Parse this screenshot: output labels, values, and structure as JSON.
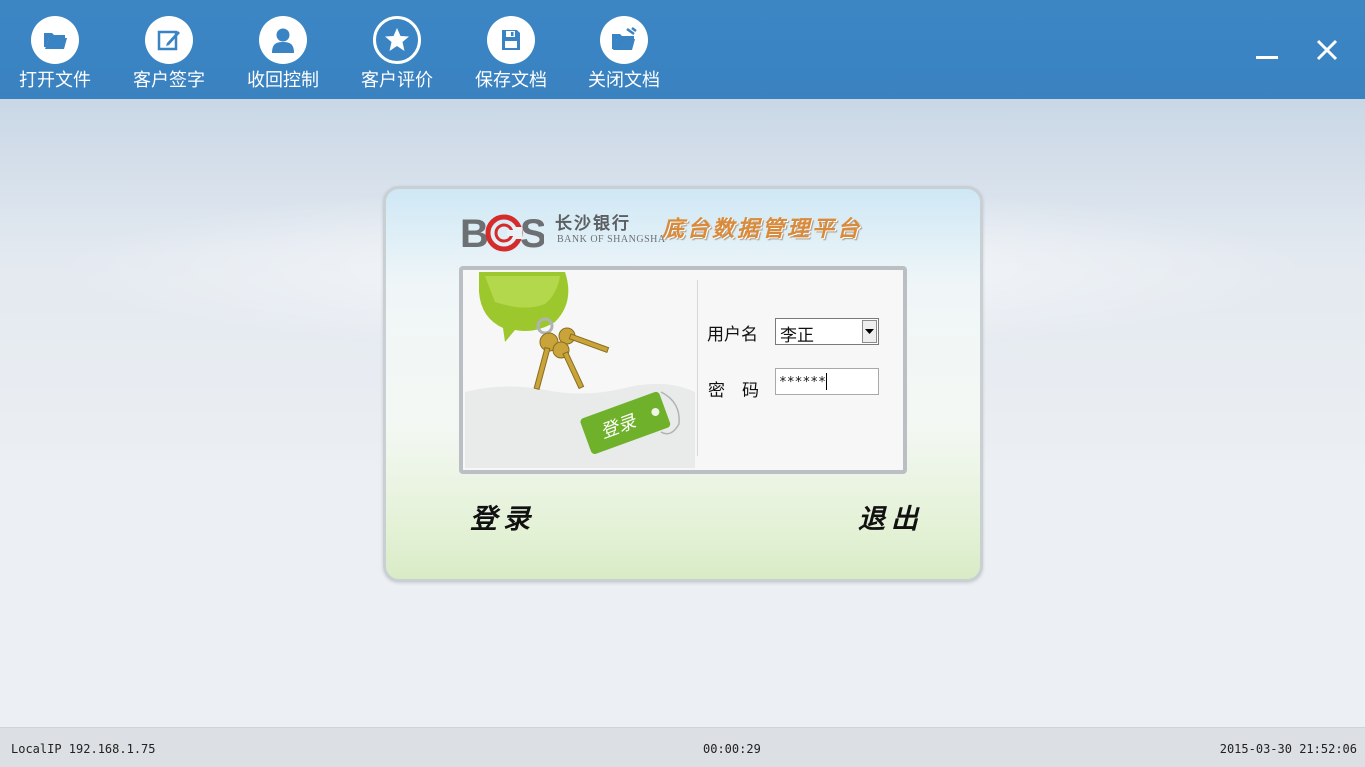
{
  "toolbar": {
    "items": [
      {
        "label": "打开文件",
        "icon": "open-folder-icon"
      },
      {
        "label": "客户签字",
        "icon": "edit-sign-icon"
      },
      {
        "label": "收回控制",
        "icon": "user-icon"
      },
      {
        "label": "客户评价",
        "icon": "star-icon"
      },
      {
        "label": "保存文档",
        "icon": "save-disk-icon"
      },
      {
        "label": "关闭文档",
        "icon": "close-folder-icon"
      }
    ],
    "bg_color": "#3a84c3"
  },
  "login": {
    "logo_letters": "BCS",
    "bank_name_cn": "长沙银行",
    "bank_name_en": "BANK OF SHANGSHA",
    "platform_title": "底台数据管理平台",
    "tag_text": "登录",
    "username_label": "用户名",
    "username_value": "李正",
    "password_label": "密　码",
    "password_value": "******",
    "login_button": "登录",
    "exit_button": "退出"
  },
  "status": {
    "local_ip": "LocalIP 192.168.1.75",
    "elapsed": "00:00:29",
    "datetime": "2015-03-30 21:52:06"
  }
}
